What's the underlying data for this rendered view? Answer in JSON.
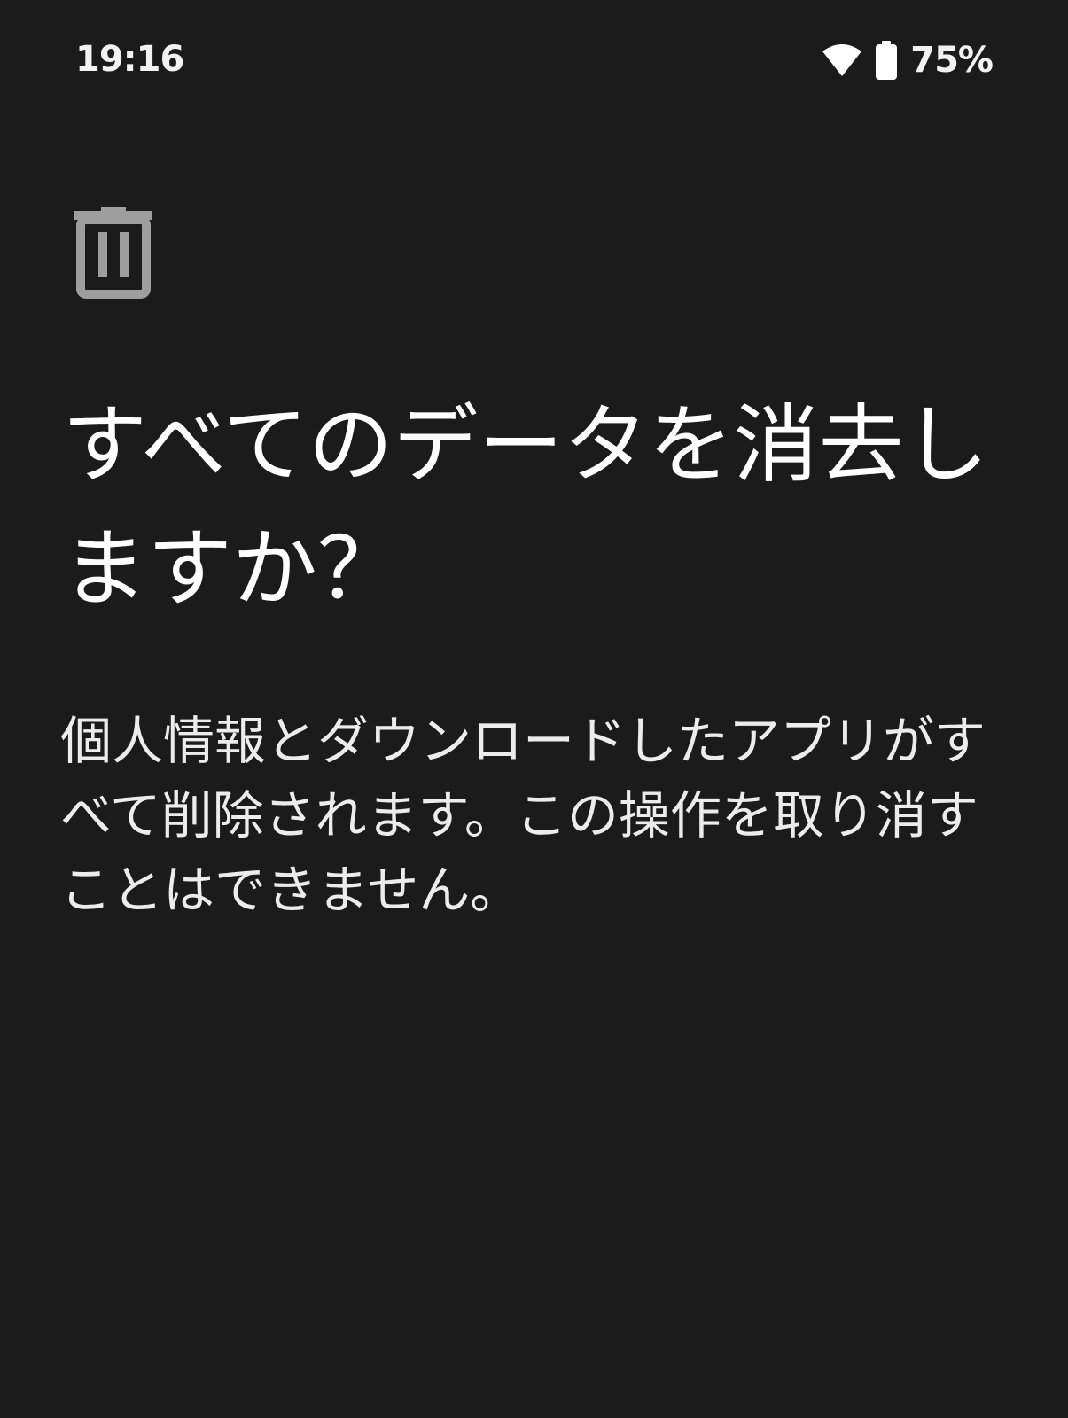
{
  "status_bar": {
    "time": "19:16",
    "battery_percent": "75%",
    "battery_level": 0.75,
    "icons": [
      "wifi-icon",
      "battery-icon"
    ]
  },
  "dialog": {
    "icon": "trash-icon",
    "title": "すべてのデータを消去しますか？",
    "message": "個人情報とダウンロードしたアプリがすべて削除されます。この操作を取り消すことはできません。"
  },
  "colors": {
    "background": "#1b1b1b",
    "text": "#ffffff",
    "icon": "#9e9e9e"
  }
}
